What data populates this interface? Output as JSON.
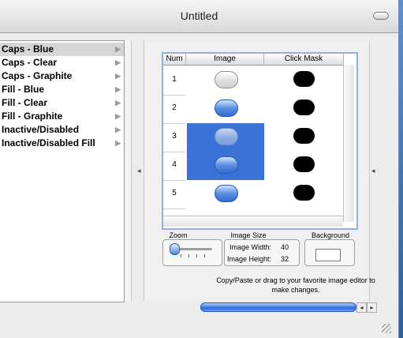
{
  "window": {
    "title": "Untitled"
  },
  "list": {
    "items": [
      {
        "label": "Caps - Blue",
        "selected": true
      },
      {
        "label": "Caps - Clear",
        "selected": false
      },
      {
        "label": "Caps - Graphite",
        "selected": false
      },
      {
        "label": "Fill - Blue",
        "selected": false
      },
      {
        "label": "Fill - Clear",
        "selected": false
      },
      {
        "label": "Fill - Graphite",
        "selected": false
      },
      {
        "label": "Inactive/Disabled",
        "selected": false
      },
      {
        "label": "Inactive/Disabled Fill",
        "selected": false
      }
    ],
    "item_arrow": "▶"
  },
  "table": {
    "headers": {
      "num": "Num",
      "image": "Image",
      "mask": "Click Mask"
    },
    "rows": [
      {
        "num": "1",
        "image": "clear",
        "selected": false
      },
      {
        "num": "2",
        "image": "blue",
        "selected": false
      },
      {
        "num": "3",
        "image": "faded",
        "selected": true
      },
      {
        "num": "4",
        "image": "blue",
        "selected": true
      },
      {
        "num": "5",
        "image": "blue",
        "selected": false
      }
    ]
  },
  "zoom": {
    "label": "Zoom",
    "level": 0.0
  },
  "image_size": {
    "label": "Image Size",
    "width_label": "Image Width:",
    "width": "40",
    "height_label": "Image Height:",
    "height": "32"
  },
  "background": {
    "label": "Background",
    "color": "#ffffff"
  },
  "hint": "Copy/Paste or drag to your favorite image editor to make changes.",
  "colors": {
    "selection": "#3b72d6",
    "accent": "#2f6bd0"
  },
  "icons": {
    "collapse_left": "◂",
    "collapse_right": "◂",
    "scroll_left": "◂",
    "scroll_right": "▸"
  }
}
